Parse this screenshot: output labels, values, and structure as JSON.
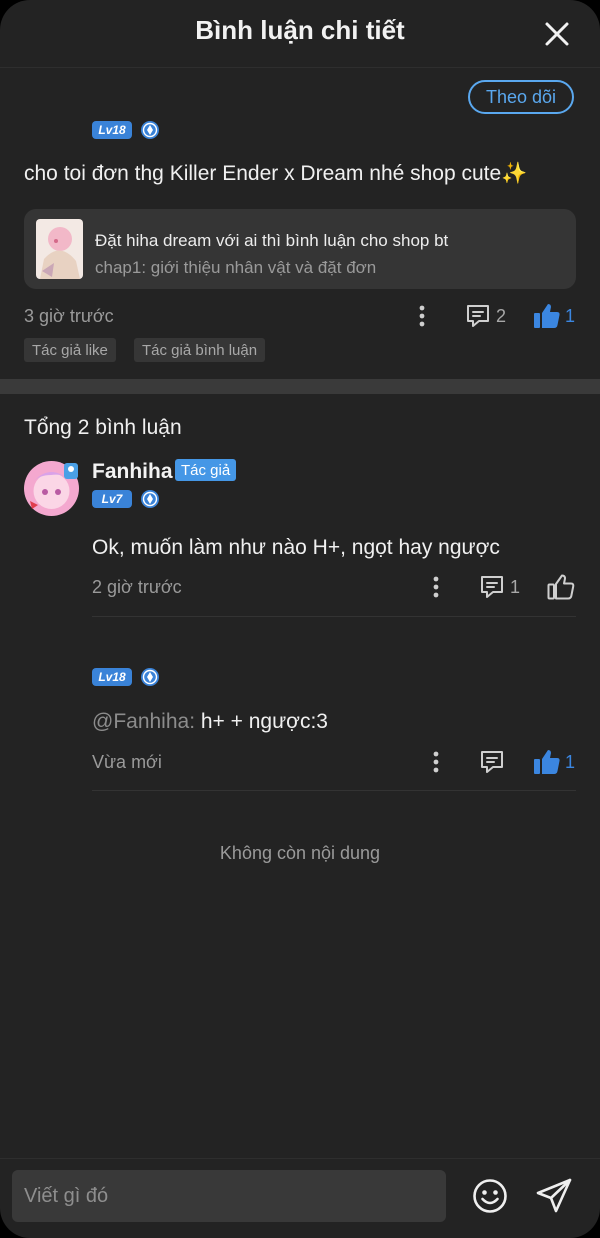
{
  "header": {
    "title": "Bình luận chi tiết"
  },
  "follow_button": "Theo dõi",
  "main_comment": {
    "level": "Lv18",
    "text": "cho toi đơn thg Killer Ender x Dream nhé shop cute✨",
    "chapter_card": {
      "title": "Đặt hiha dream với ai thì bình luận cho shop bt",
      "subtitle": "chap1: giới thiệu nhân vật và đặt đơn"
    },
    "time": "3 giờ trước",
    "reply_count": "2",
    "like_count": "1",
    "liked": true,
    "tags": [
      "Tác giả like",
      "Tác giả bình luận"
    ]
  },
  "total_label": "Tổng 2 bình luận",
  "replies": [
    {
      "name": "Fanhiha",
      "badge": "Tác giả",
      "level": "Lv7",
      "text": "Ok, muốn làm như nào H+, ngọt hay ngược",
      "time": "2 giờ trước",
      "reply_count": "1",
      "liked": false
    },
    {
      "level": "Lv18",
      "mention": "@Fanhiha:",
      "text": " h+ + ngược:3",
      "time": "Vừa mới",
      "like_count": "1",
      "liked": true
    }
  ],
  "end_label": "Không còn nội dung",
  "composer": {
    "placeholder": "Viết gì đó"
  },
  "colors": {
    "accent": "#3b86e0",
    "follow": "#5aa8ef",
    "background": "#232323"
  },
  "icons": [
    "close-icon",
    "gem-icon",
    "more-vertical-icon",
    "comment-icon",
    "thumbs-up-icon",
    "emoji-icon",
    "send-icon"
  ]
}
